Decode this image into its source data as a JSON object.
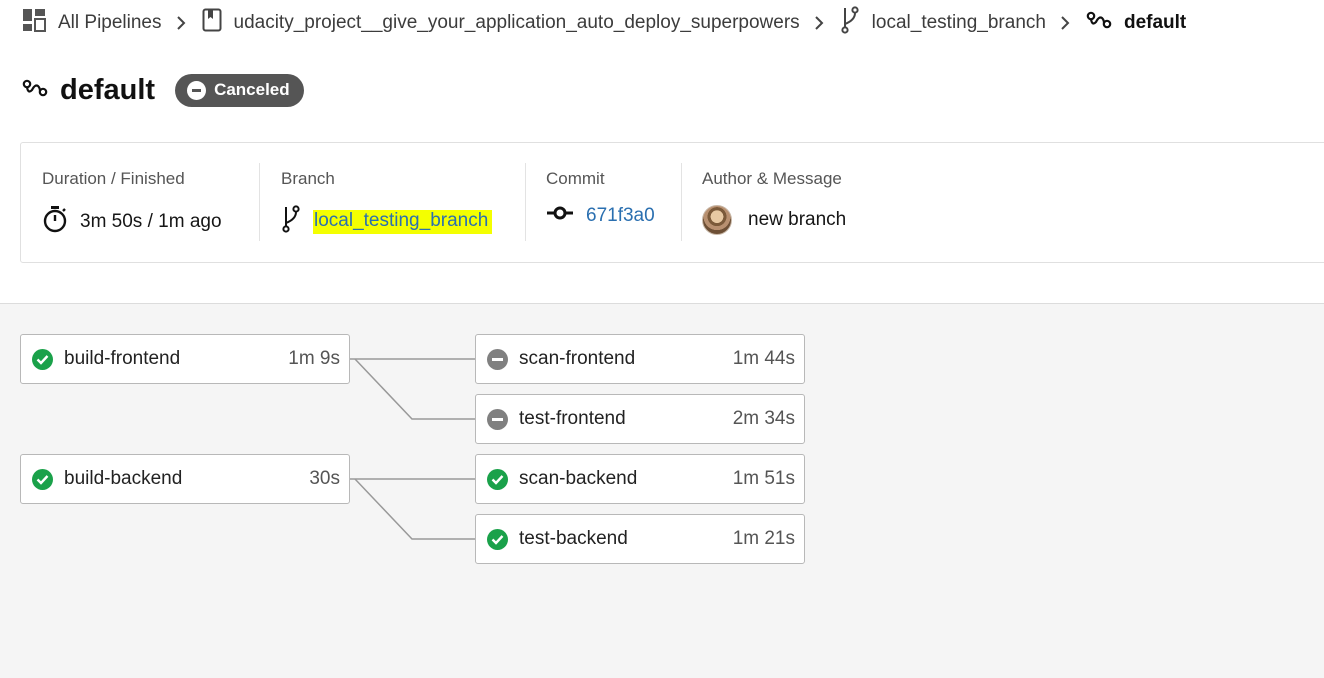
{
  "breadcrumb": {
    "pipelines_label": "All Pipelines",
    "project_label": "udacity_project__give_your_application_auto_deploy_superpowers",
    "branch_label": "local_testing_branch",
    "workflow_label": "default"
  },
  "header": {
    "title": "default",
    "status": "Canceled"
  },
  "summary": {
    "duration_label": "Duration / Finished",
    "duration_value": "3m 50s / 1m ago",
    "branch_label": "Branch",
    "branch_value": "local_testing_branch",
    "commit_label": "Commit",
    "commit_value": "671f3a0",
    "author_label": "Author & Message",
    "message_value": "new branch"
  },
  "jobs": {
    "build_frontend": {
      "name": "build-frontend",
      "duration": "1m 9s",
      "status": "success"
    },
    "scan_frontend": {
      "name": "scan-frontend",
      "duration": "1m 44s",
      "status": "canceled"
    },
    "test_frontend": {
      "name": "test-frontend",
      "duration": "2m 34s",
      "status": "canceled"
    },
    "build_backend": {
      "name": "build-backend",
      "duration": "30s",
      "status": "success"
    },
    "scan_backend": {
      "name": "scan-backend",
      "duration": "1m 51s",
      "status": "success"
    },
    "test_backend": {
      "name": "test-backend",
      "duration": "1m 21s",
      "status": "success"
    }
  },
  "colors": {
    "success": "#1aa14a",
    "canceled": "#808080",
    "link": "#2a6fb0",
    "highlight": "#f4ff00"
  }
}
